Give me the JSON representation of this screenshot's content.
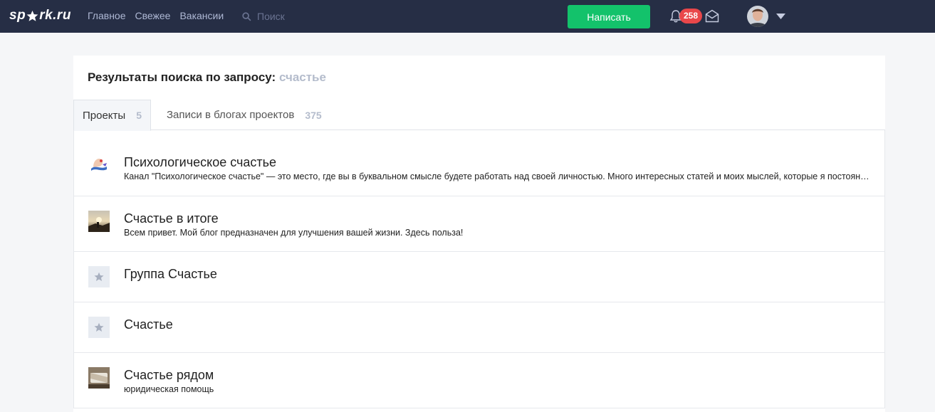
{
  "header": {
    "logo_left": "sp",
    "logo_right": "rk.ru",
    "nav": [
      "Главное",
      "Свежее",
      "Вакансии"
    ],
    "search_placeholder": "Поиск",
    "write_label": "Написать",
    "notifications_count": "258",
    "icons": {
      "logo_mark": "star-icon",
      "search": "search-icon",
      "bell": "bell-icon",
      "mail": "mail-icon",
      "caret": "caret-down-icon"
    }
  },
  "search": {
    "heading": "Результаты поиска по запросу:",
    "query": "счастье"
  },
  "tabs": [
    {
      "label": "Проекты",
      "count": "5",
      "active": true
    },
    {
      "label": "Записи в блогах проектов",
      "count": "375",
      "active": false
    }
  ],
  "results": [
    {
      "title": "Психологическое счастье",
      "desc": "Канал \"Психологическое счастье\" — это место, где вы в буквальном смысле будете работать над своей личностью. Много интересных статей и моих мыслей, которые я постоянно пишу",
      "thumb": "illustration"
    },
    {
      "title": "Счастье в итоге",
      "desc": "Всем привет. Мой блог предназначен для улучшения вашей жизни. Здесь польза!",
      "thumb": "photo"
    },
    {
      "title": "Группа Счастье",
      "desc": "",
      "thumb": "star-placeholder"
    },
    {
      "title": "Счастье",
      "desc": "",
      "thumb": "star-placeholder"
    },
    {
      "title": "Счастье рядом",
      "desc": "юридическая помощь",
      "thumb": "photo"
    }
  ],
  "colors": {
    "topbar": "#262e45",
    "accent_green": "#13c26b",
    "badge_red": "#e9474a",
    "muted": "#b4bccc"
  }
}
